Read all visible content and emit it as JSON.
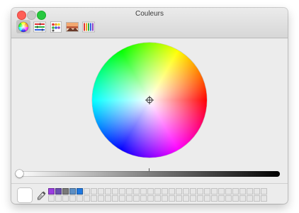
{
  "window": {
    "title": "Couleurs"
  },
  "toolbar": {
    "items": [
      {
        "icon": "color-wheel-icon",
        "selected": true
      },
      {
        "icon": "color-sliders-icon",
        "selected": false
      },
      {
        "icon": "color-palettes-icon",
        "selected": false
      },
      {
        "icon": "image-palettes-icon",
        "selected": false
      },
      {
        "icon": "pencils-icon",
        "selected": false
      }
    ]
  },
  "color_wheel": {
    "selected_color": "#ffffff"
  },
  "brightness_slider": {
    "value": 1.0
  },
  "current_color": "#ffffff",
  "swatches": {
    "colors": [
      "#9b3de0",
      "#6a4fb0",
      "#7a7a7a",
      "#5d8fc4",
      "#1f78e0"
    ]
  }
}
